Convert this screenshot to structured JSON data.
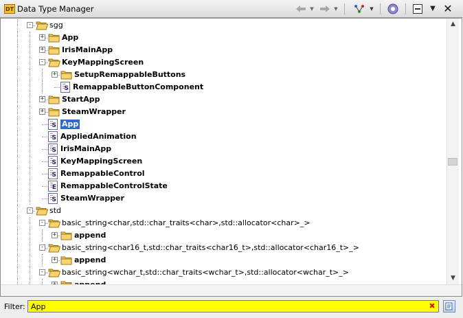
{
  "window": {
    "title": "Data Type Manager",
    "icon_text": "DT"
  },
  "toolbar": {
    "back_icon": "arrow-left-icon",
    "forward_icon": "arrow-right-icon",
    "filter_menu_icon": "network-icon",
    "refresh_icon": "gear-refresh-icon",
    "collapse_icon": "collapse-all-icon",
    "menu_icon": "triangle-down-icon",
    "close_icon": "close-icon"
  },
  "tree": [
    {
      "depth": 2,
      "exp": "-",
      "icon": "folder-open",
      "label": "sgg",
      "bold": false
    },
    {
      "depth": 3,
      "exp": "+",
      "icon": "folder",
      "label": "App",
      "bold": true
    },
    {
      "depth": 3,
      "exp": "+",
      "icon": "folder",
      "label": "IrisMainApp",
      "bold": true
    },
    {
      "depth": 3,
      "exp": "-",
      "icon": "folder-open",
      "label": "KeyMappingScreen",
      "bold": true
    },
    {
      "depth": 4,
      "exp": "+",
      "icon": "folder",
      "label": "SetupRemappableButtons",
      "bold": true
    },
    {
      "depth": 4,
      "exp": "",
      "icon": "struct",
      "label": "RemappableButtonComponent",
      "bold": true
    },
    {
      "depth": 3,
      "exp": "+",
      "icon": "folder",
      "label": "StartApp",
      "bold": true
    },
    {
      "depth": 3,
      "exp": "+",
      "icon": "folder",
      "label": "SteamWrapper",
      "bold": true
    },
    {
      "depth": 3,
      "exp": "",
      "icon": "struct",
      "label": "App",
      "bold": true,
      "selected": true
    },
    {
      "depth": 3,
      "exp": "",
      "icon": "struct",
      "label": "AppliedAnimation",
      "bold": true
    },
    {
      "depth": 3,
      "exp": "",
      "icon": "struct",
      "label": "IrisMainApp",
      "bold": true
    },
    {
      "depth": 3,
      "exp": "",
      "icon": "struct",
      "label": "KeyMappingScreen",
      "bold": true
    },
    {
      "depth": 3,
      "exp": "",
      "icon": "struct",
      "label": "RemappableControl",
      "bold": true
    },
    {
      "depth": 3,
      "exp": "",
      "icon": "enum",
      "label": "RemappableControlState",
      "bold": true
    },
    {
      "depth": 3,
      "exp": "",
      "icon": "struct",
      "label": "SteamWrapper",
      "bold": true
    },
    {
      "depth": 2,
      "exp": "-",
      "icon": "folder-open",
      "label": "std",
      "bold": false
    },
    {
      "depth": 3,
      "exp": "-",
      "icon": "folder-open",
      "label": "basic_string<char,std::char_traits<char>,std::allocator<char>_>",
      "bold": false
    },
    {
      "depth": 4,
      "exp": "+",
      "icon": "folder",
      "label": "append",
      "bold": true
    },
    {
      "depth": 3,
      "exp": "-",
      "icon": "folder-open",
      "label": "basic_string<char16_t,std::char_traits<char16_t>,std::allocator<char16_t>_>",
      "bold": false
    },
    {
      "depth": 4,
      "exp": "+",
      "icon": "folder",
      "label": "append",
      "bold": true
    },
    {
      "depth": 3,
      "exp": "-",
      "icon": "folder-open",
      "label": "basic_string<wchar_t,std::char_traits<wchar_t>,std::allocator<wchar_t>_>",
      "bold": false
    },
    {
      "depth": 4,
      "exp": "+",
      "icon": "folder",
      "label": "append",
      "bold": true
    }
  ],
  "filter": {
    "label": "Filter:",
    "value": "App",
    "clear_icon": "clear-x-icon",
    "options_icon": "filter-options-icon"
  },
  "scrollbar": {
    "up_icon": "scroll-up-icon",
    "down_icon": "scroll-down-icon"
  }
}
